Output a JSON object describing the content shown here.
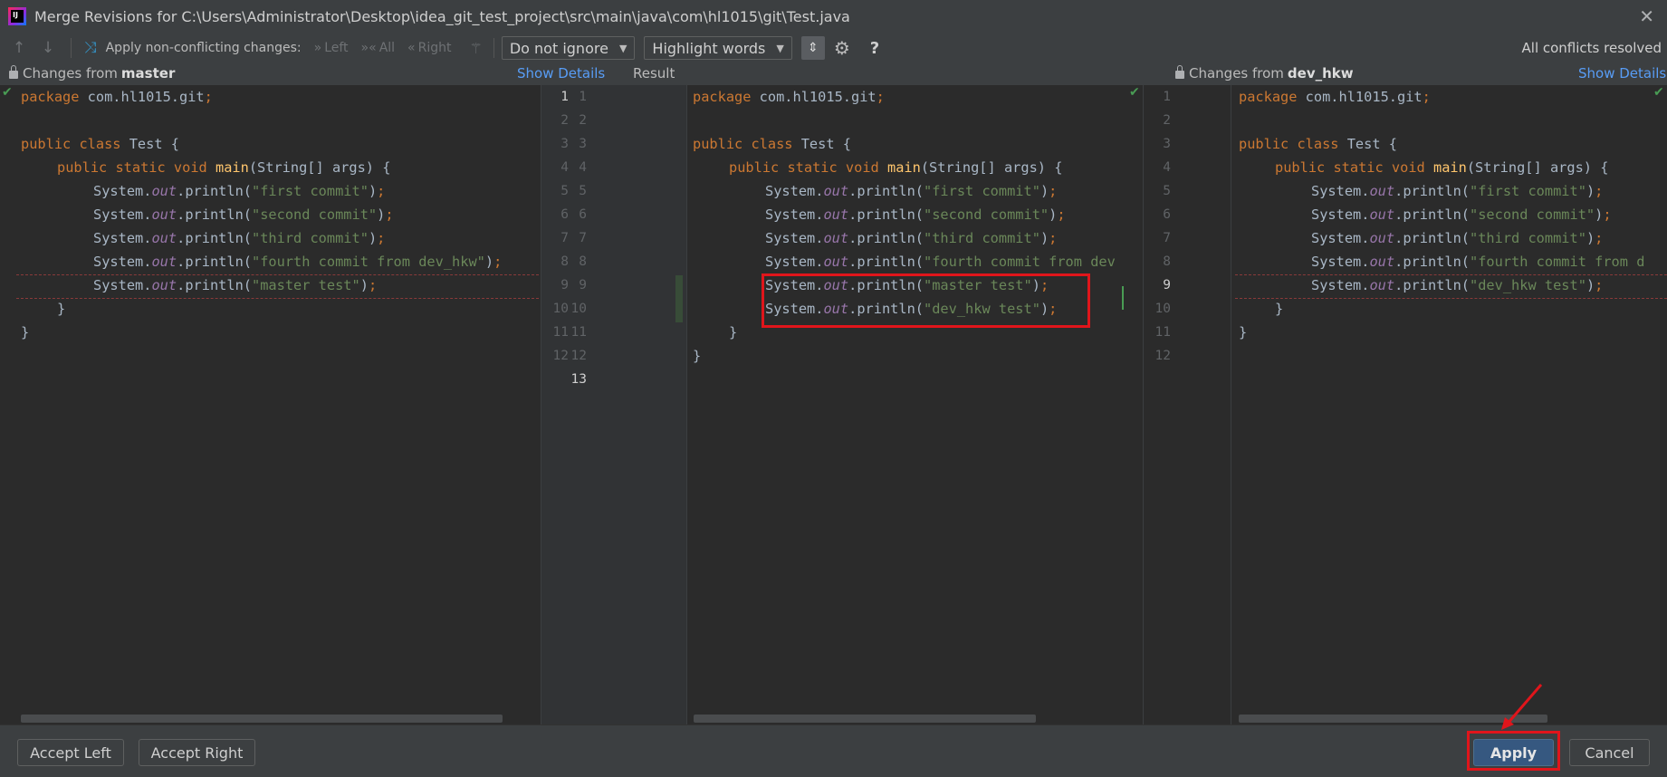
{
  "window": {
    "title": "Merge Revisions for C:\\Users\\Administrator\\Desktop\\idea_git_test_project\\src\\main\\java\\com\\hl1015\\git\\Test.java",
    "icon_text": "IJ",
    "close_glyph": "✕"
  },
  "toolbar": {
    "apply_non_conflicting_label": "Apply non-conflicting changes:",
    "left_label": "Left",
    "all_label": "All",
    "right_label": "Right",
    "ignore_dropdown": "Do not ignore",
    "highlight_dropdown": "Highlight words",
    "help": "?",
    "status": "All conflicts resolved"
  },
  "panels": {
    "left_header_prefix": "Changes from",
    "left_branch": "master",
    "left_show_details": "Show Details",
    "result_header": "Result",
    "right_header_prefix": "Changes from",
    "right_branch": "dev_hkw",
    "right_show_details": "Show Details"
  },
  "gutters": {
    "left_numbers": [
      "1",
      "2",
      "3",
      "4",
      "5",
      "6",
      "7",
      "8",
      "9",
      "10",
      "11",
      "12"
    ],
    "result_numbers": [
      "1",
      "2",
      "3",
      "4",
      "5",
      "6",
      "7",
      "8",
      "9",
      "10",
      "11",
      "12",
      "13"
    ],
    "right_numbers": [
      "1",
      "2",
      "3",
      "4",
      "5",
      "6",
      "7",
      "8",
      "9",
      "10",
      "11",
      "12"
    ]
  },
  "code": {
    "package_kw": "package",
    "package_name": " com.hl1015.git",
    "semi": ";",
    "class_decl_kw": "public class",
    "class_name": " Test {",
    "main_kw": "public static void",
    "main_fn": "main",
    "main_args": "(String[] args) {",
    "sys": "System.",
    "out": "out",
    "println_open": ".println(",
    "close_paren_semi": ");",
    "close_paren": ")",
    "first": "\"first commit\"",
    "second": "\"second commit\"",
    "third": "\"third commit\"",
    "fourth": "\"fourth commit from dev_hkw\"",
    "fourth_result_cut": "\"fourth commit from dev",
    "fourth_right_cut": "\"fourth commit from d",
    "master_test": "\"master test\"",
    "dev_test": "\"dev_hkw test\"",
    "brace_inner": "}",
    "brace_outer": "}"
  },
  "buttons": {
    "accept_left": "Accept Left",
    "accept_right": "Accept Right",
    "apply": "Apply",
    "cancel": "Cancel"
  },
  "colors": {
    "annotation_red": "#e0151b",
    "resolved_green": "#499c54",
    "link_blue": "#589df6"
  }
}
